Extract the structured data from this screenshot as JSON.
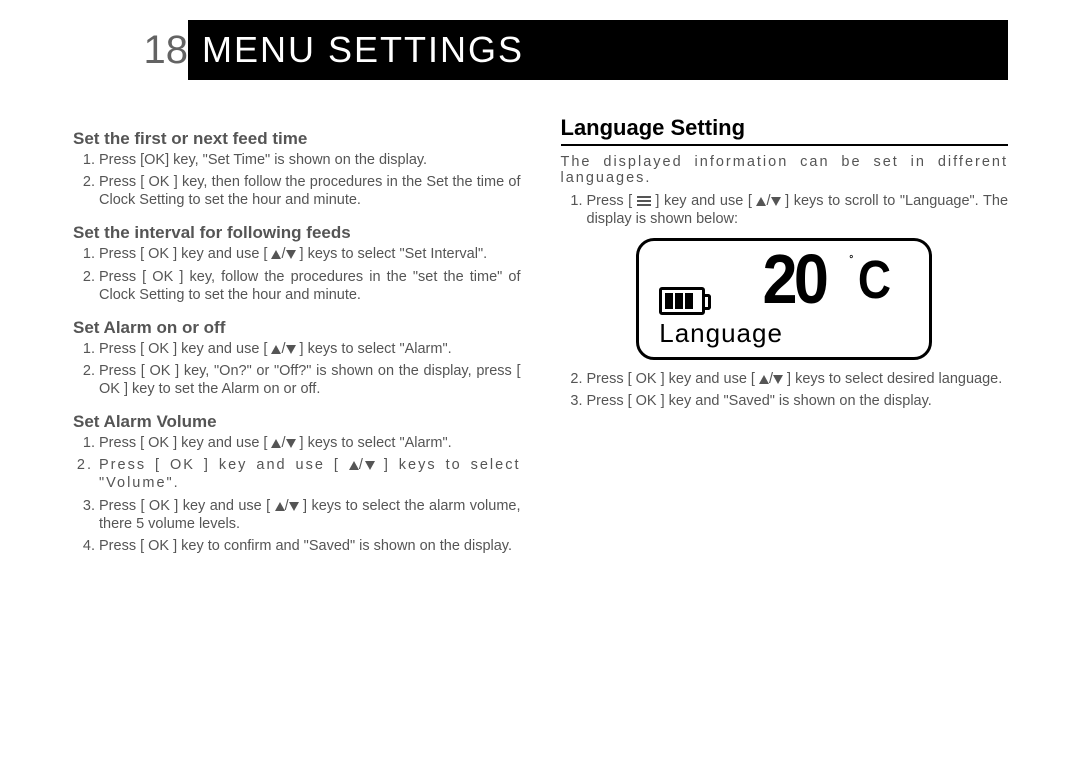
{
  "header": {
    "page_number": "18",
    "title": "MENU SETTINGS"
  },
  "left": {
    "sec1": {
      "heading": "Set the first or next feed time",
      "steps": [
        "Press [OK] key, \"Set Time\" is shown on the display.",
        "Press [ OK ] key, then follow the procedures in the Set the time of Clock Setting to set the hour and minute."
      ]
    },
    "sec2": {
      "heading": "Set the interval for following feeds",
      "steps": [
        "Press [ OK ] key and use [ ▲/▼ ] keys to select \"Set Interval\".",
        "Press [ OK ] key, follow the procedures in the \"set the time\" of Clock Setting to set the hour and minute."
      ]
    },
    "sec3": {
      "heading": "Set Alarm on or off",
      "steps": [
        "Press [ OK ] key and use [ ▲/▼ ] keys to select \"Alarm\".",
        "Press [ OK ] key, \"On?\" or \"Off?\" is shown on the display, press [ OK ] key to set the Alarm on or off."
      ]
    },
    "sec4": {
      "heading": "Set Alarm Volume",
      "steps": [
        "Press [ OK ] key and use [ ▲/▼ ] keys to select \"Alarm\".",
        "Press [ OK ] key and use [ ▲/▼ ] keys to select \"Volume\".",
        "Press [ OK ] key and use [ ▲/▼ ] keys to select the alarm volume, there 5 volume levels.",
        "Press [ OK ] key to confirm and \"Saved\" is shown on the display."
      ]
    }
  },
  "right": {
    "section_heading": "Language Setting",
    "lead": "The displayed information can be set in different languages.",
    "steps_before": [
      "Press [ ≡ ] key and use [ ▲/▼ ] keys to scroll to \"Language\". The display is shown below:"
    ],
    "display": {
      "value": "20",
      "unit": "C",
      "deg": "°",
      "label": "Language",
      "battery_level": 3
    },
    "steps_after": [
      "Press [ OK ] key and use [ ▲/▼ ] keys to select desired language.",
      "Press [ OK ] key and \"Saved\" is shown on the display."
    ]
  },
  "icons": {
    "up": "up-triangle-icon",
    "down": "down-triangle-icon",
    "menu": "hamburger-icon",
    "battery": "battery-icon"
  }
}
